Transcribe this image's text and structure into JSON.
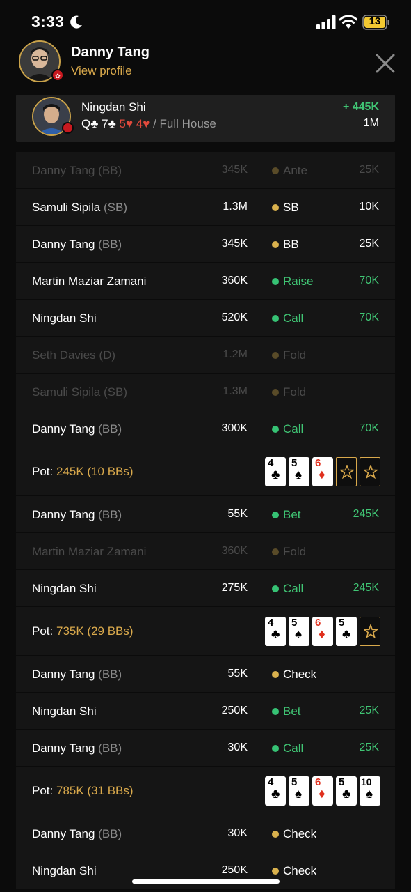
{
  "status_bar": {
    "time": "3:33",
    "battery": "13"
  },
  "header": {
    "player_name": "Danny Tang",
    "link_label": "View profile"
  },
  "winner": {
    "name": "Ningdan Shi",
    "gain": "+ 445K",
    "stack": "1M",
    "hand": [
      {
        "rank": "Q",
        "suit": "♣",
        "color": "black"
      },
      {
        "rank": "7",
        "suit": "♣",
        "color": "black"
      },
      {
        "rank": "5",
        "suit": "♥",
        "color": "red"
      },
      {
        "rank": "4",
        "suit": "♥",
        "color": "red"
      }
    ],
    "hand_description": "/ Full House"
  },
  "colors": {
    "accent_gold": "#d9a94c",
    "positive_green": "#40c574",
    "dot_yellow": "#d9b14d",
    "dot_green": "#36c274",
    "dot_dim": "#6b6438",
    "red_suit": "#e0301e"
  },
  "actions": [
    {
      "type": "action",
      "name": "Danny Tang",
      "role": "(BB)",
      "stack": "345K",
      "action": "Ante",
      "amount": "25K",
      "dot": "yellow",
      "faded": true
    },
    {
      "type": "action",
      "name": "Samuli Sipila",
      "role": "(SB)",
      "stack": "1.3M",
      "action": "SB",
      "amount": "10K",
      "dot": "yellow",
      "faded": false
    },
    {
      "type": "action",
      "name": "Danny Tang",
      "role": "(BB)",
      "stack": "345K",
      "action": "BB",
      "amount": "25K",
      "dot": "yellow",
      "faded": false
    },
    {
      "type": "action",
      "name": "Martin Maziar Zamani",
      "role": "",
      "stack": "360K",
      "action": "Raise",
      "amount": "70K",
      "dot": "green",
      "faded": false
    },
    {
      "type": "action",
      "name": "Ningdan Shi",
      "role": "",
      "stack": "520K",
      "action": "Call",
      "amount": "70K",
      "dot": "green",
      "faded": false
    },
    {
      "type": "action",
      "name": "Seth Davies",
      "role": "(D)",
      "stack": "1.2M",
      "action": "Fold",
      "amount": "",
      "dot": "yellow",
      "faded": true
    },
    {
      "type": "action",
      "name": "Samuli Sipila",
      "role": "(SB)",
      "stack": "1.3M",
      "action": "Fold",
      "amount": "",
      "dot": "yellow",
      "faded": true
    },
    {
      "type": "action",
      "name": "Danny Tang",
      "role": "(BB)",
      "stack": "300K",
      "action": "Call",
      "amount": "70K",
      "dot": "green",
      "faded": false
    },
    {
      "type": "pot",
      "label": "Pot:",
      "value": "245K (10 BBs)",
      "cards": [
        {
          "rank": "4",
          "suit": "♣",
          "color": "black"
        },
        {
          "rank": "5",
          "suit": "♠",
          "color": "black"
        },
        {
          "rank": "6",
          "suit": "♦",
          "color": "red"
        },
        {
          "placeholder": true
        },
        {
          "placeholder": true
        }
      ]
    },
    {
      "type": "action",
      "name": "Danny Tang",
      "role": "(BB)",
      "stack": "55K",
      "action": "Bet",
      "amount": "245K",
      "dot": "green",
      "faded": false
    },
    {
      "type": "action",
      "name": "Martin Maziar Zamani",
      "role": "",
      "stack": "360K",
      "action": "Fold",
      "amount": "",
      "dot": "yellow",
      "faded": true
    },
    {
      "type": "action",
      "name": "Ningdan Shi",
      "role": "",
      "stack": "275K",
      "action": "Call",
      "amount": "245K",
      "dot": "green",
      "faded": false
    },
    {
      "type": "pot",
      "label": "Pot:",
      "value": "735K (29 BBs)",
      "cards": [
        {
          "rank": "4",
          "suit": "♣",
          "color": "black"
        },
        {
          "rank": "5",
          "suit": "♠",
          "color": "black"
        },
        {
          "rank": "6",
          "suit": "♦",
          "color": "red"
        },
        {
          "rank": "5",
          "suit": "♣",
          "color": "black"
        },
        {
          "placeholder": true
        }
      ]
    },
    {
      "type": "action",
      "name": "Danny Tang",
      "role": "(BB)",
      "stack": "55K",
      "action": "Check",
      "amount": "",
      "dot": "yellow",
      "faded": false
    },
    {
      "type": "action",
      "name": "Ningdan Shi",
      "role": "",
      "stack": "250K",
      "action": "Bet",
      "amount": "25K",
      "dot": "green",
      "faded": false
    },
    {
      "type": "action",
      "name": "Danny Tang",
      "role": "(BB)",
      "stack": "30K",
      "action": "Call",
      "amount": "25K",
      "dot": "green",
      "faded": false
    },
    {
      "type": "pot",
      "label": "Pot:",
      "value": "785K (31 BBs)",
      "cards": [
        {
          "rank": "4",
          "suit": "♣",
          "color": "black"
        },
        {
          "rank": "5",
          "suit": "♠",
          "color": "black"
        },
        {
          "rank": "6",
          "suit": "♦",
          "color": "red"
        },
        {
          "rank": "5",
          "suit": "♣",
          "color": "black"
        },
        {
          "rank": "10",
          "suit": "♠",
          "color": "black"
        }
      ]
    },
    {
      "type": "action",
      "name": "Danny Tang",
      "role": "(BB)",
      "stack": "30K",
      "action": "Check",
      "amount": "",
      "dot": "yellow",
      "faded": false
    },
    {
      "type": "action",
      "name": "Ningdan Shi",
      "role": "",
      "stack": "250K",
      "action": "Check",
      "amount": "",
      "dot": "yellow",
      "faded": false
    }
  ]
}
